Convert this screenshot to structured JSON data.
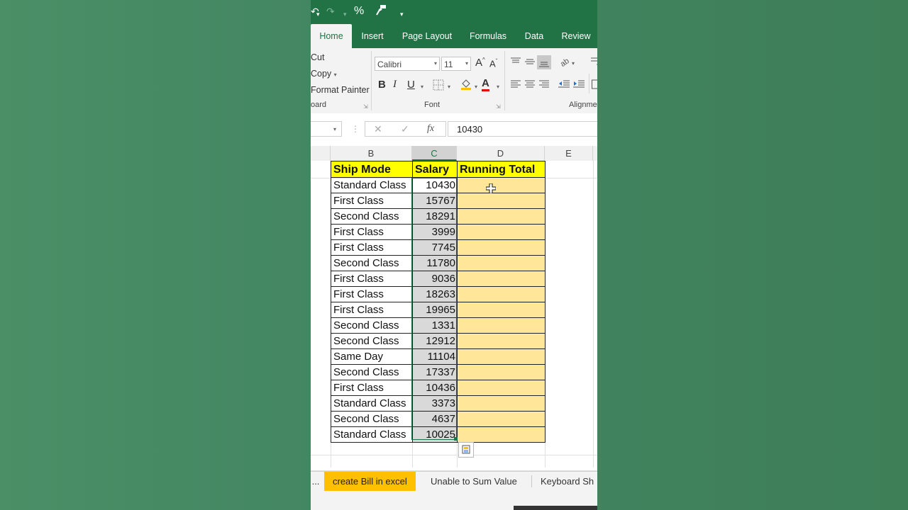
{
  "quick_access": {
    "percent_label": "%"
  },
  "tabs": [
    {
      "label": "Home"
    },
    {
      "label": "Insert"
    },
    {
      "label": "Page Layout"
    },
    {
      "label": "Formulas"
    },
    {
      "label": "Data"
    },
    {
      "label": "Review"
    }
  ],
  "ribbon": {
    "clipboard": {
      "cut": "Cut",
      "copy": "Copy",
      "format_painter": "Format Painter",
      "group": "oard"
    },
    "font": {
      "name": "Calibri",
      "size": "11",
      "bold": "B",
      "italic": "I",
      "underline": "U",
      "font_color": "A",
      "grow": "A",
      "shrink": "A",
      "group": "Font"
    },
    "alignment": {
      "group": "Alignme"
    }
  },
  "formula_bar": {
    "fx": "fx",
    "value": "10430"
  },
  "columns": [
    "B",
    "C",
    "D",
    "E"
  ],
  "table": {
    "headers": [
      "Ship Mode",
      "Salary",
      "Running Total"
    ],
    "rows": [
      {
        "mode": "Standard Class",
        "salary": "10430"
      },
      {
        "mode": "First Class",
        "salary": "15767"
      },
      {
        "mode": "Second Class",
        "salary": "18291"
      },
      {
        "mode": "First Class",
        "salary": "3999"
      },
      {
        "mode": "First Class",
        "salary": "7745"
      },
      {
        "mode": "Second Class",
        "salary": "11780"
      },
      {
        "mode": "First Class",
        "salary": "9036"
      },
      {
        "mode": "First Class",
        "salary": "18263"
      },
      {
        "mode": "First Class",
        "salary": "19965"
      },
      {
        "mode": "Second Class",
        "salary": "1331"
      },
      {
        "mode": "Second Class",
        "salary": "12912"
      },
      {
        "mode": "Same Day",
        "salary": "11104"
      },
      {
        "mode": "Second Class",
        "salary": "17337"
      },
      {
        "mode": "First Class",
        "salary": "10436"
      },
      {
        "mode": "Standard Class",
        "salary": "3373"
      },
      {
        "mode": "Second Class",
        "salary": "4637"
      },
      {
        "mode": "Standard Class",
        "salary": "10025"
      }
    ]
  },
  "sheets": {
    "more": "...",
    "tabs": [
      {
        "label": "create Bill in excel"
      },
      {
        "label": "Unable to Sum Value"
      },
      {
        "label": "Keyboard Sh"
      }
    ]
  },
  "colors": {
    "excel_green": "#217346",
    "header_yellow": "#ffff00",
    "running_total_fill": "#ffe699",
    "active_sheet_tab": "#ffc000",
    "background": "#458a62"
  }
}
